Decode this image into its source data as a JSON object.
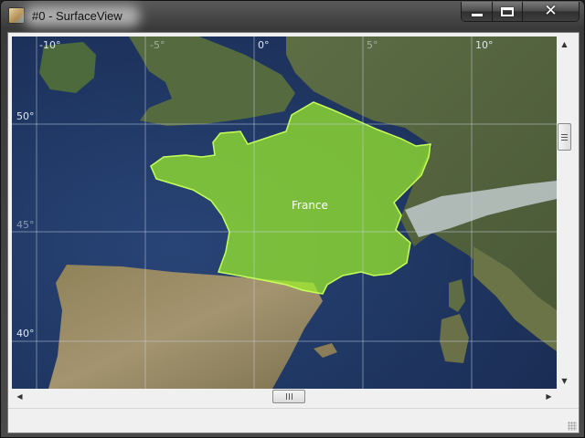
{
  "window": {
    "title": "#0 - SurfaceView",
    "icon": "surfaceview-app-icon",
    "close_glyph": "✕"
  },
  "map": {
    "longitude_labels": [
      "-10°",
      "-5°",
      "0°",
      "5°",
      "10°"
    ],
    "latitude_labels": [
      "50°",
      "45°",
      "40°"
    ],
    "highlighted_region": {
      "name": "France",
      "fill_color": "#9cf02a",
      "outline_color": "#c6ff5a"
    },
    "colors": {
      "sea": "#20335e",
      "land": "#4f5f3a",
      "grid": "#c8d4e4"
    }
  },
  "scrollbars": {
    "vertical": {
      "up_icon": "▲",
      "down_icon": "▼"
    },
    "horizontal": {
      "left_icon": "◀",
      "right_icon": "▶"
    }
  }
}
